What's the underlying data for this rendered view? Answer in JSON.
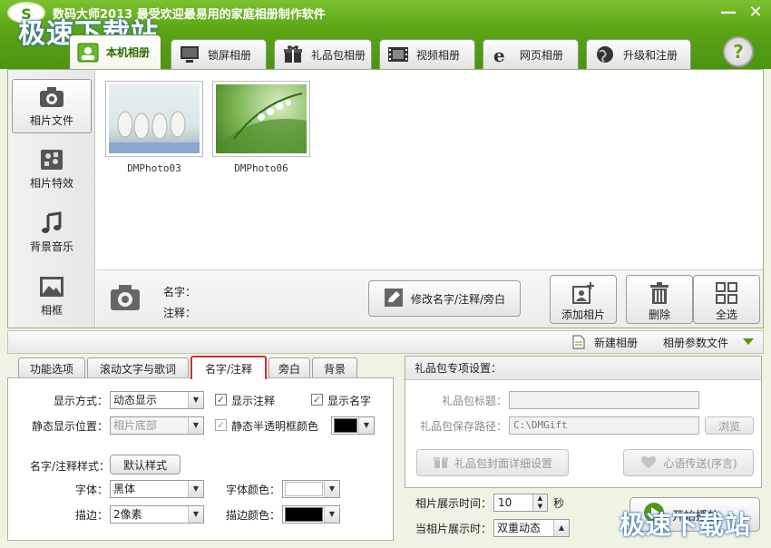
{
  "window": {
    "title": "数码大师2013   最受欢迎最易用的家庭相册制作软件",
    "logo_text": "S",
    "watermark": "极速下载站",
    "minimize": "—",
    "close": "✕",
    "help": "?"
  },
  "tabs": [
    {
      "label": "本机相册",
      "active": true
    },
    {
      "label": "锁屏相册"
    },
    {
      "label": "礼品包相册"
    },
    {
      "label": "视频相册"
    },
    {
      "label": "网页相册"
    },
    {
      "label": "升级和注册"
    }
  ],
  "sidebar": {
    "items": [
      {
        "label": "相片文件",
        "icon": "camera-icon",
        "active": true
      },
      {
        "label": "相片特效",
        "icon": "effects-icon"
      },
      {
        "label": "背景音乐",
        "icon": "music-note-icon"
      },
      {
        "label": "相框",
        "icon": "frame-icon"
      }
    ]
  },
  "photos": [
    {
      "name": "DMPhoto03"
    },
    {
      "name": "DMPhoto06"
    }
  ],
  "info": {
    "name_label": "名字：",
    "note_label": "注释：",
    "edit_button": "修改名字/注释/旁白",
    "add_photo": "添加相片",
    "delete": "删除",
    "select_all": "全选"
  },
  "midbar": {
    "new_album": "新建相册",
    "params_file": "相册参数文件"
  },
  "subtabs": [
    {
      "label": "功能选项"
    },
    {
      "label": "滚动文字与歌词"
    },
    {
      "label": "名字/注释",
      "active": true
    },
    {
      "label": "旁白"
    },
    {
      "label": "背景"
    }
  ],
  "settings": {
    "display_mode_label": "显示方式：",
    "display_mode_value": "动态显示",
    "show_note_label": "显示注释",
    "show_name_label": "显示名字",
    "static_pos_label": "静态显示位置：",
    "static_pos_value": "相片底部",
    "static_frame_label": "静态半透明框颜色",
    "style_label": "名字/注释样式：",
    "default_style_button": "默认样式",
    "font_label": "字体：",
    "font_value": "黑体",
    "font_color_label": "字体颜色：",
    "stroke_label": "描边：",
    "stroke_value": "2像素",
    "stroke_color_label": "描边颜色：",
    "check_mark": "✓",
    "colors": {
      "frame": "#000000",
      "font": "#ffffff",
      "stroke": "#000000"
    }
  },
  "gift": {
    "header": "礼品包专项设置：",
    "title_label": "礼品包标题：",
    "title_value": "",
    "path_label": "礼品包保存路径：",
    "path_value": "C:\\DMGift",
    "browse": "浏览",
    "cover_button": "礼品包封面详细设置",
    "message_button": "心语传送(序言)"
  },
  "playback": {
    "show_time_label": "相片展示时间：",
    "show_time_value": "10",
    "seconds": "秒",
    "current_label": "当相片展示时：",
    "current_value": "双重动态",
    "start_button": "开始播放"
  }
}
